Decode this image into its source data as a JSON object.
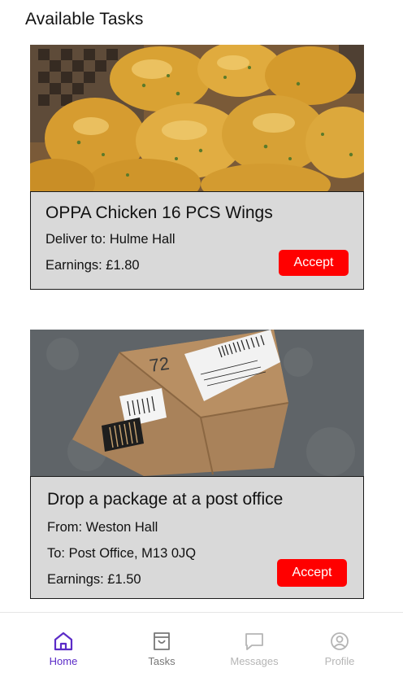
{
  "page_title": "Available Tasks",
  "tasks": [
    {
      "title": "OPPA Chicken 16 PCS Wings",
      "lines": [
        "Deliver to: Hulme Hall",
        "Earnings: £1.80"
      ],
      "accept_label": "Accept"
    },
    {
      "title": "Drop a package at a post office",
      "lines": [
        "From: Weston Hall",
        "To: Post Office, M13 0JQ",
        "Earnings: £1.50"
      ],
      "accept_label": "Accept",
      "parcel_mark": "72"
    }
  ],
  "nav": {
    "items": [
      {
        "label": "Home",
        "icon": "home-icon"
      },
      {
        "label": "Tasks",
        "icon": "shopping-bag-icon"
      },
      {
        "label": "Messages",
        "icon": "message-icon"
      },
      {
        "label": "Profile",
        "icon": "user-circle-icon"
      }
    ],
    "active": "Home"
  },
  "colors": {
    "accent": "#5b2bc7",
    "accept_button": "#ff0000",
    "card_background": "#d9d9d9"
  }
}
